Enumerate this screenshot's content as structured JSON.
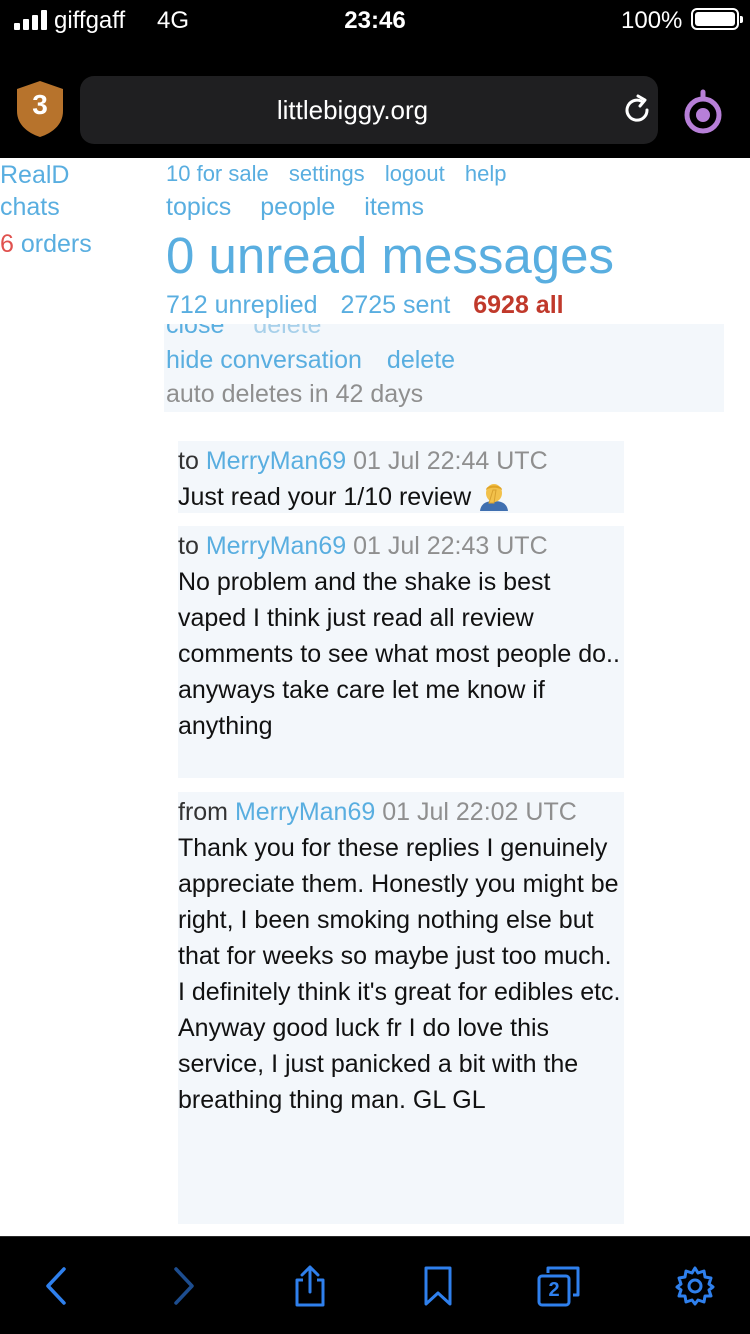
{
  "status_bar": {
    "carrier": "giffgaff",
    "network": "4G",
    "time": "23:46",
    "battery_percent": "100%",
    "signal_bars": 4
  },
  "toolbar": {
    "shield_count": "3",
    "url": "littlebiggy.org",
    "reload_icon": "reload-icon",
    "onion_icon": "onion-icon"
  },
  "left_nav": {
    "reald": "RealD",
    "chats": "chats",
    "orders_count": "6",
    "orders_label": " orders"
  },
  "top_nav": {
    "for_sale": "10 for sale",
    "settings": "settings",
    "logout": "logout",
    "help": "help",
    "topics": "topics",
    "people": "people",
    "items": "items"
  },
  "messages_header": {
    "unread": "0 unread messages",
    "unreplied": "712 unreplied",
    "sent": "2725 sent",
    "all": "6928 all"
  },
  "conversation": {
    "cut_close": "close",
    "cut_delete": "delete",
    "hide": "hide conversation",
    "delete": "delete",
    "auto_delete": "auto deletes in 42 days"
  },
  "messages": [
    {
      "direction": "to",
      "user": "MerryMan69",
      "time": " 01 Jul 22:44 UTC",
      "body": "Just read your 1/10 review",
      "emoji": "facepalm-emoji"
    },
    {
      "direction": "to",
      "user": "MerryMan69",
      "time": " 01 Jul 22:43 UTC",
      "body": "No problem and the shake is best vaped I think just read all review comments to see what most people do..\nanyways take care let me know if anything"
    },
    {
      "direction": "from",
      "user": "MerryMan69",
      "time": " 01 Jul 22:02 UTC",
      "body": "Thank you for these replies I genuinely appreciate them. Honestly you might be right, I been smoking nothing else but that for weeks so maybe just too much. I definitely think it's great for edibles etc. Anyway good luck fr I do love this service, I just panicked a bit with the breathing thing man. GL GL"
    }
  ],
  "bottom_bar": {
    "tab_count": "2",
    "icons": [
      "back-icon",
      "forward-icon",
      "share-icon",
      "bookmarks-icon",
      "tabs-icon",
      "settings-gear-icon"
    ]
  },
  "colors": {
    "link": "#59aee0",
    "orders_accent": "#e0514e",
    "all_accent": "#c0392b",
    "shield": "#b7732c",
    "browser_blue": "#2f80ed",
    "onion": "#b77fd8"
  }
}
